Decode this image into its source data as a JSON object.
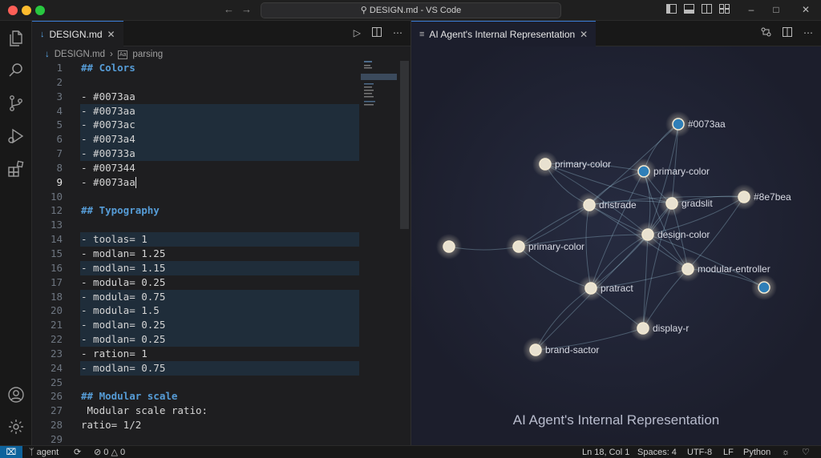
{
  "window": {
    "title": "DESIGN.md - VS Code"
  },
  "activity_bar": {
    "icons": [
      "files-icon",
      "search-icon",
      "source-control-icon",
      "run-debug-icon",
      "extensions-icon",
      "account-icon",
      "settings-gear-icon"
    ]
  },
  "left_editor": {
    "tab_label": "DESIGN.md",
    "breadcrumb": {
      "file": "DESIGN.md",
      "symbol": "parsing"
    },
    "lines": [
      {
        "n": "1",
        "text": "## Colors",
        "heading": true
      },
      {
        "n": "2",
        "text": ""
      },
      {
        "n": "3",
        "text": "- #0073aa"
      },
      {
        "n": "4",
        "text": "- #0073aa",
        "hl": true
      },
      {
        "n": "5",
        "text": "- #0073ac",
        "hl": true
      },
      {
        "n": "6",
        "text": "- #0073a4",
        "hl": true
      },
      {
        "n": "7",
        "text": "- #00733a",
        "hl": true
      },
      {
        "n": "8",
        "text": "- #007344"
      },
      {
        "n": "9",
        "text": "- #0073aa",
        "current": true
      },
      {
        "n": "10",
        "text": ""
      },
      {
        "n": "12",
        "text": "## Typography",
        "heading": true
      },
      {
        "n": "13",
        "text": ""
      },
      {
        "n": "14",
        "text": "- toolas= 1",
        "hl": true
      },
      {
        "n": "15",
        "text": "- modlan= 1.25"
      },
      {
        "n": "16",
        "text": "- modlan= 1.15",
        "hl": true
      },
      {
        "n": "17",
        "text": "- modula= 0.25"
      },
      {
        "n": "18",
        "text": "- modula= 0.75",
        "hl": true
      },
      {
        "n": "20",
        "text": "- modula= 1.5",
        "hl": true
      },
      {
        "n": "21",
        "text": "- modlan= 0.25",
        "hl": true
      },
      {
        "n": "22",
        "text": "- modlan= 0.25",
        "hl": true
      },
      {
        "n": "23",
        "text": "- ration= 1"
      },
      {
        "n": "24",
        "text": "- modlan= 0.75",
        "hl": true
      },
      {
        "n": "25",
        "text": ""
      },
      {
        "n": "26",
        "text": "## Modular scale",
        "heading": true
      },
      {
        "n": "27",
        "text": " Modular scale ratio:"
      },
      {
        "n": "28",
        "text": "ratio= 1/2"
      },
      {
        "n": "29",
        "text": ""
      }
    ]
  },
  "right_editor": {
    "tab_label": "AI Agent's Internal Representation",
    "caption": "AI Agent's Internal Representation",
    "graph": {
      "node_color": "#e8e1d0",
      "accent_node_color": "#2f7fb8",
      "nodes": [
        {
          "label": "#0073aa",
          "accent": true
        },
        {
          "label": "primary-color",
          "accent": false
        },
        {
          "label": "primary-color",
          "accent": true
        },
        {
          "label": "dristrade",
          "accent": false
        },
        {
          "label": "gradslit",
          "accent": false
        },
        {
          "label": "#8e7bea",
          "accent": false
        },
        {
          "label": "",
          "accent": false
        },
        {
          "label": "primary-color",
          "accent": false
        },
        {
          "label": "design-color",
          "accent": false
        },
        {
          "label": "modular-entroller",
          "accent": false
        },
        {
          "label": "pratract",
          "accent": false
        },
        {
          "label": "",
          "accent": true
        },
        {
          "label": "display-r",
          "accent": false
        },
        {
          "label": "brand-sactor",
          "accent": false
        }
      ]
    }
  },
  "status_bar": {
    "branch": "agent",
    "errors": "0",
    "warnings": "0",
    "position": "Ln 18, Col 1",
    "spaces": "Spaces: 4",
    "encoding": "UTF-8",
    "eol": "LF",
    "language": "Python"
  }
}
